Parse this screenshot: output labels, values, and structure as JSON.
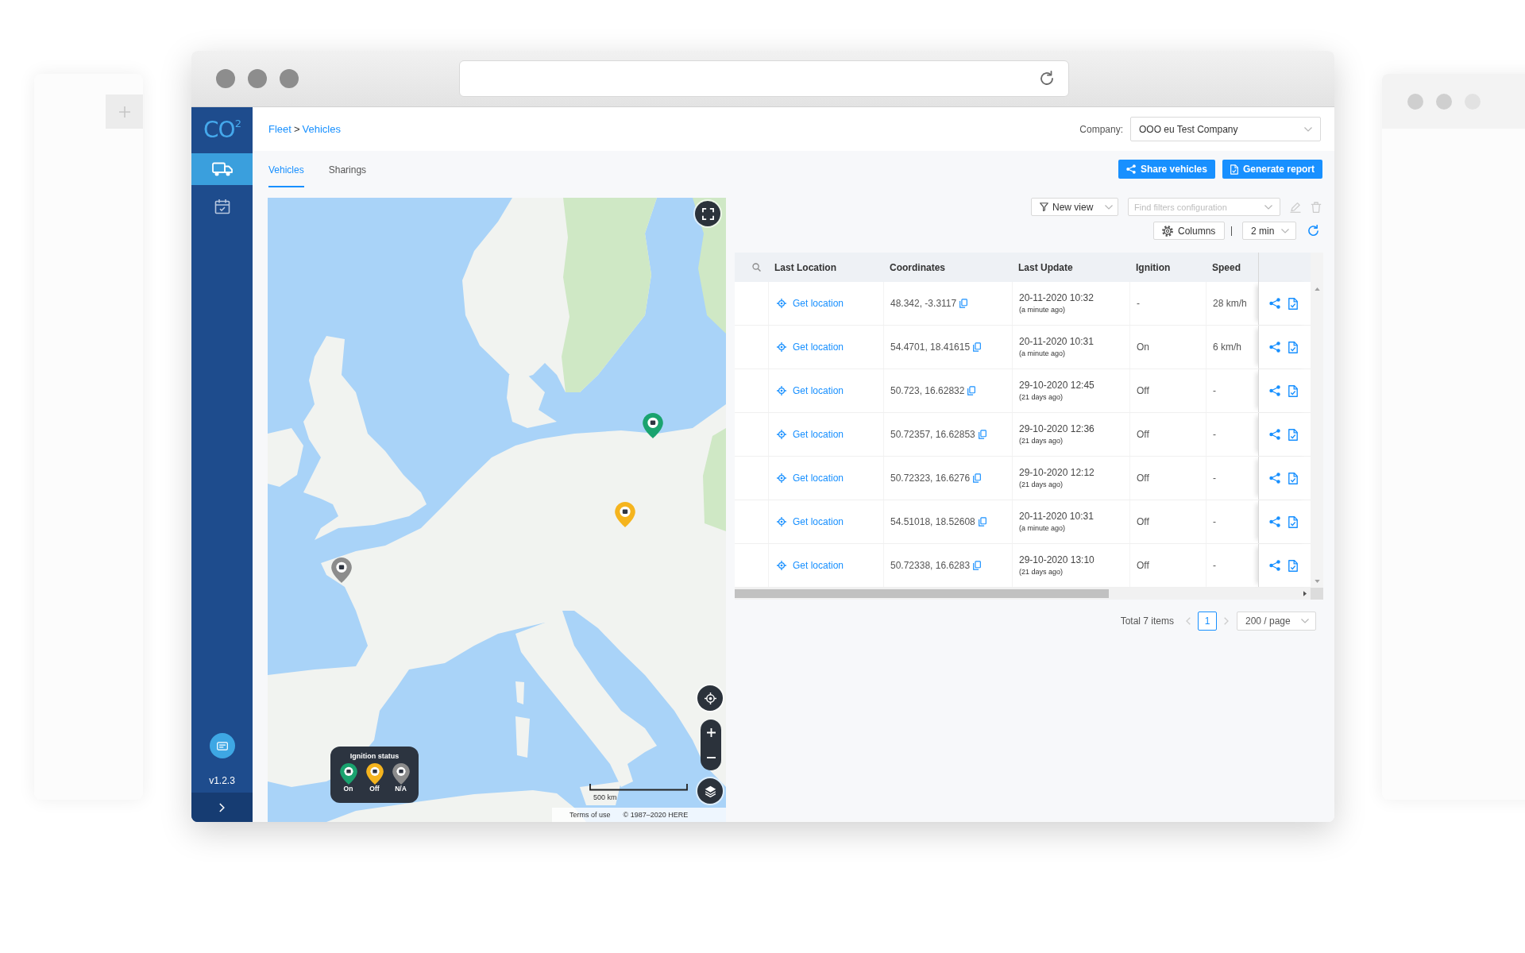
{
  "sidebar": {
    "logo": "CO$^{2}$",
    "items": [
      {
        "selected": true
      },
      {
        "selected": false
      }
    ],
    "version": "v1.2.3"
  },
  "header": {
    "breadcrumb": [
      "Fleet",
      "Vehicles"
    ],
    "separator": ">",
    "company_label": "Company:",
    "company": "OOO eu Test Company"
  },
  "tabs": [
    {
      "label": "Vehicles",
      "selected": true
    },
    {
      "label": "Sharings",
      "selected": false
    }
  ],
  "buttons": [
    "Share vehicles",
    "Generate report"
  ],
  "map": {
    "markers": [
      {
        "color": "#8c8c8c"
      },
      {
        "color": "#1aa36f"
      },
      {
        "color": "#f5b41e"
      }
    ],
    "legend": {
      "title": "Ignition status",
      "items": [
        {
          "label": "On",
          "color": "#1aa36f"
        },
        {
          "label": "Off",
          "color": "#f5b41e"
        },
        {
          "label": "N/A",
          "color": "#8c8c8c"
        }
      ]
    },
    "scale": "500 km",
    "attribution": [
      "Terms of use",
      "© 1987–2020 HERE"
    ]
  },
  "toolbar": {
    "view": "New view",
    "filter": {
      "placeholder": "Find filters configuration"
    },
    "actions_disabled": true,
    "columns": "Columns",
    "interval": "2 min"
  },
  "table": {
    "columns": [
      "Last Location",
      "Coordinates",
      "Last Update",
      "Ignition",
      "Speed"
    ],
    "rows": [
      {
        "location": "Get location",
        "coordinates": "48.342, -3.3117",
        "time": "20-11-2020 10:32",
        "ago": "(a minute ago)",
        "ignition": "-",
        "speed": "28 km/h"
      },
      {
        "location": "Get location",
        "coordinates": "54.4701, 18.41615",
        "time": "20-11-2020 10:31",
        "ago": "(a minute ago)",
        "ignition": "On",
        "speed": "6 km/h"
      },
      {
        "location": "Get location",
        "coordinates": "50.723, 16.62832",
        "time": "29-10-2020 12:45",
        "ago": "(21 days ago)",
        "ignition": "Off",
        "speed": "-"
      },
      {
        "location": "Get location",
        "coordinates": "50.72357, 16.62853",
        "time": "29-10-2020 12:36",
        "ago": "(21 days ago)",
        "ignition": "Off",
        "speed": "-"
      },
      {
        "location": "Get location",
        "coordinates": "50.72323, 16.6276",
        "time": "29-10-2020 12:12",
        "ago": "(21 days ago)",
        "ignition": "Off",
        "speed": "-"
      },
      {
        "location": "Get location",
        "coordinates": "54.51018, 18.52608",
        "time": "20-11-2020 10:31",
        "ago": "(a minute ago)",
        "ignition": "Off",
        "speed": "-"
      },
      {
        "location": "Get location",
        "coordinates": "50.72338, 16.6283",
        "time": "29-10-2020 13:10",
        "ago": "(21 days ago)",
        "ignition": "Off",
        "speed": "-"
      }
    ]
  },
  "pagination": {
    "total": "Total 7 items",
    "prev_disabled": true,
    "pages": [
      {
        "label": "1",
        "selected": true
      }
    ],
    "next_disabled": true,
    "page_size": "200 / page"
  }
}
